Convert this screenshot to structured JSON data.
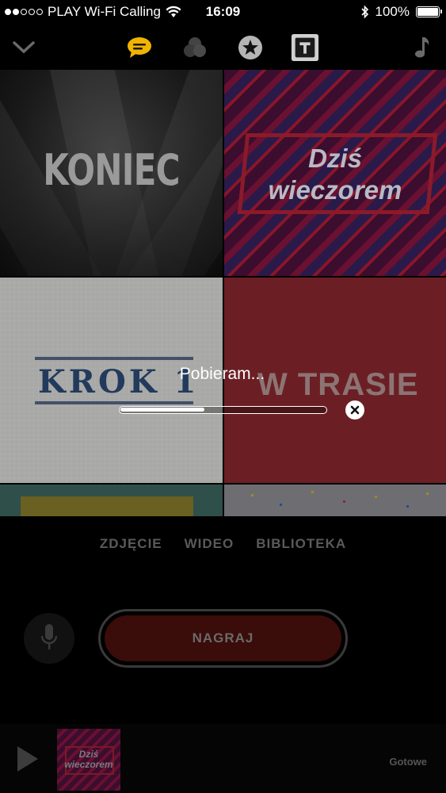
{
  "status_bar": {
    "carrier": "PLAY Wi-Fi Calling",
    "time": "16:09",
    "battery": "100%"
  },
  "toolbar": {
    "icons": [
      "chevron-down-icon",
      "speech-bubble-icon",
      "filters-icon",
      "star-icon",
      "text-icon",
      "music-note-icon"
    ],
    "active_color": "#f0b400"
  },
  "title_cards": [
    {
      "text": "KONIEC"
    },
    {
      "line1": "Dziś",
      "line2": "wieczorem"
    },
    {
      "text": "KROK 1"
    },
    {
      "text": "W TRASIE"
    }
  ],
  "download": {
    "label": "Pobieram...",
    "progress": 0.41
  },
  "modes": {
    "photo": "ZDJĘCIE",
    "video": "WIDEO",
    "library": "BIBLIOTEKA"
  },
  "record": {
    "label": "NAGRAJ"
  },
  "bottom": {
    "thumb_line1": "Dziś",
    "thumb_line2": "wieczorem",
    "done": "Gotowe"
  }
}
